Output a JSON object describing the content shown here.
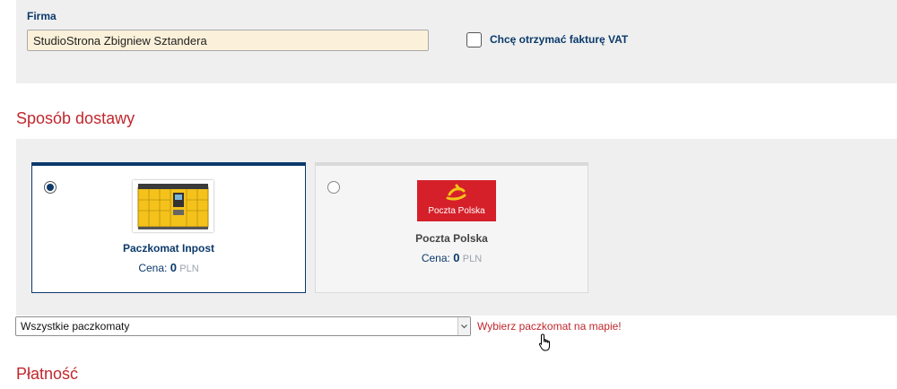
{
  "company": {
    "label": "Firma",
    "value": "StudioStrona Zbigniew Sztandera",
    "vat_checkbox_checked": false,
    "vat_label": "Chcę otrzymać fakturę VAT"
  },
  "delivery": {
    "title": "Sposób dostawy",
    "options": [
      {
        "name": "Paczkomat Inpost",
        "price_label": "Cena:",
        "price_value": "0",
        "currency": "PLN",
        "selected": true,
        "icon": "inpost-locker-icon"
      },
      {
        "name": "Poczta Polska",
        "logo_text": "Poczta Polska",
        "price_label": "Cena:",
        "price_value": "0",
        "currency": "PLN",
        "selected": false,
        "icon": "poczta-polska-logo"
      }
    ],
    "locker_select": {
      "value": "Wszystkie paczkomaty"
    },
    "map_link": "Wybierz paczkomat na mapie!"
  },
  "payment": {
    "title": "Płatność"
  },
  "colors": {
    "accent_red": "#c1272d",
    "navy": "#0b3a6b",
    "panel_bg": "#efefef",
    "input_bg": "#fbf0d9"
  }
}
